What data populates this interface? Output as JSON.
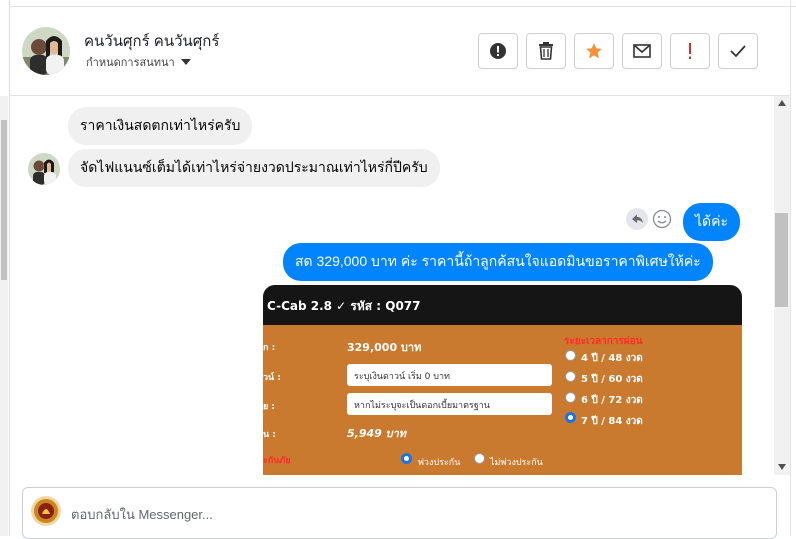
{
  "header": {
    "contact_name": "คนวันศุกร์ คนวันศุกร์",
    "subtitle": "กำหนดการสนทนา",
    "actions": [
      {
        "name": "report-icon",
        "color": "#333333"
      },
      {
        "name": "trash-icon",
        "color": "#333333"
      },
      {
        "name": "star-icon",
        "color": "#f7923a"
      },
      {
        "name": "mail-icon",
        "color": "#333333"
      },
      {
        "name": "priority-icon",
        "color": "#d93025"
      },
      {
        "name": "check-icon",
        "color": "#333333"
      }
    ]
  },
  "messages": {
    "incoming_1": "ราคาเงินสดตกเท่าไหร่ครับ",
    "incoming_2": "จัดไฟแนนซ์เต็มได้เท่าไหร่จ่ายงวดประมาณเท่าไหร่กี่ปีครับ",
    "outgoing_1": "ได้ค่ะ",
    "outgoing_2": "สด 329,000 บาท ค่ะ ราคานี้ถ้าลูกค้สนใจแอดมินขอราคาพิเศษให้ค่ะ"
  },
  "attachment": {
    "title": "C-Cab 2.8 ✓ รหัส : Q077",
    "label_price": "ก :",
    "label_down": "วน์ :",
    "label_rate": "ย :",
    "label_monthly": "น :",
    "label_insurance": "ะกันภัย",
    "price_value": "329,000 บาท",
    "down_placeholder": "ระบุเงินดาวน์ เริ่ม 0 บาท",
    "rate_placeholder": "หากไม่ระบุจะเป็นดอกเบี้ยมาตรฐาน",
    "monthly_value": "5,949 บาท",
    "plan_title": "ระยะเวลาการผ่อน",
    "plans": [
      "4 ปี / 48 งวด",
      "5 ปี / 60 งวด",
      "6 ปี / 72 งวด",
      "7 ปี / 84 งวด"
    ],
    "selected_plan": "7 ปี / 84 งวด",
    "insurance_options": [
      "พ่วงประกัน",
      "ไม่พ่วงประกัน"
    ],
    "selected_insurance": "พ่วงประกัน"
  },
  "composer": {
    "placeholder": "ตอบกลับใน Messenger..."
  },
  "colors": {
    "outgoing_bubble": "#0084ff",
    "incoming_bubble": "#f0f0f0",
    "attachment_bg": "#c97a2e",
    "accent_star": "#f7923a"
  }
}
